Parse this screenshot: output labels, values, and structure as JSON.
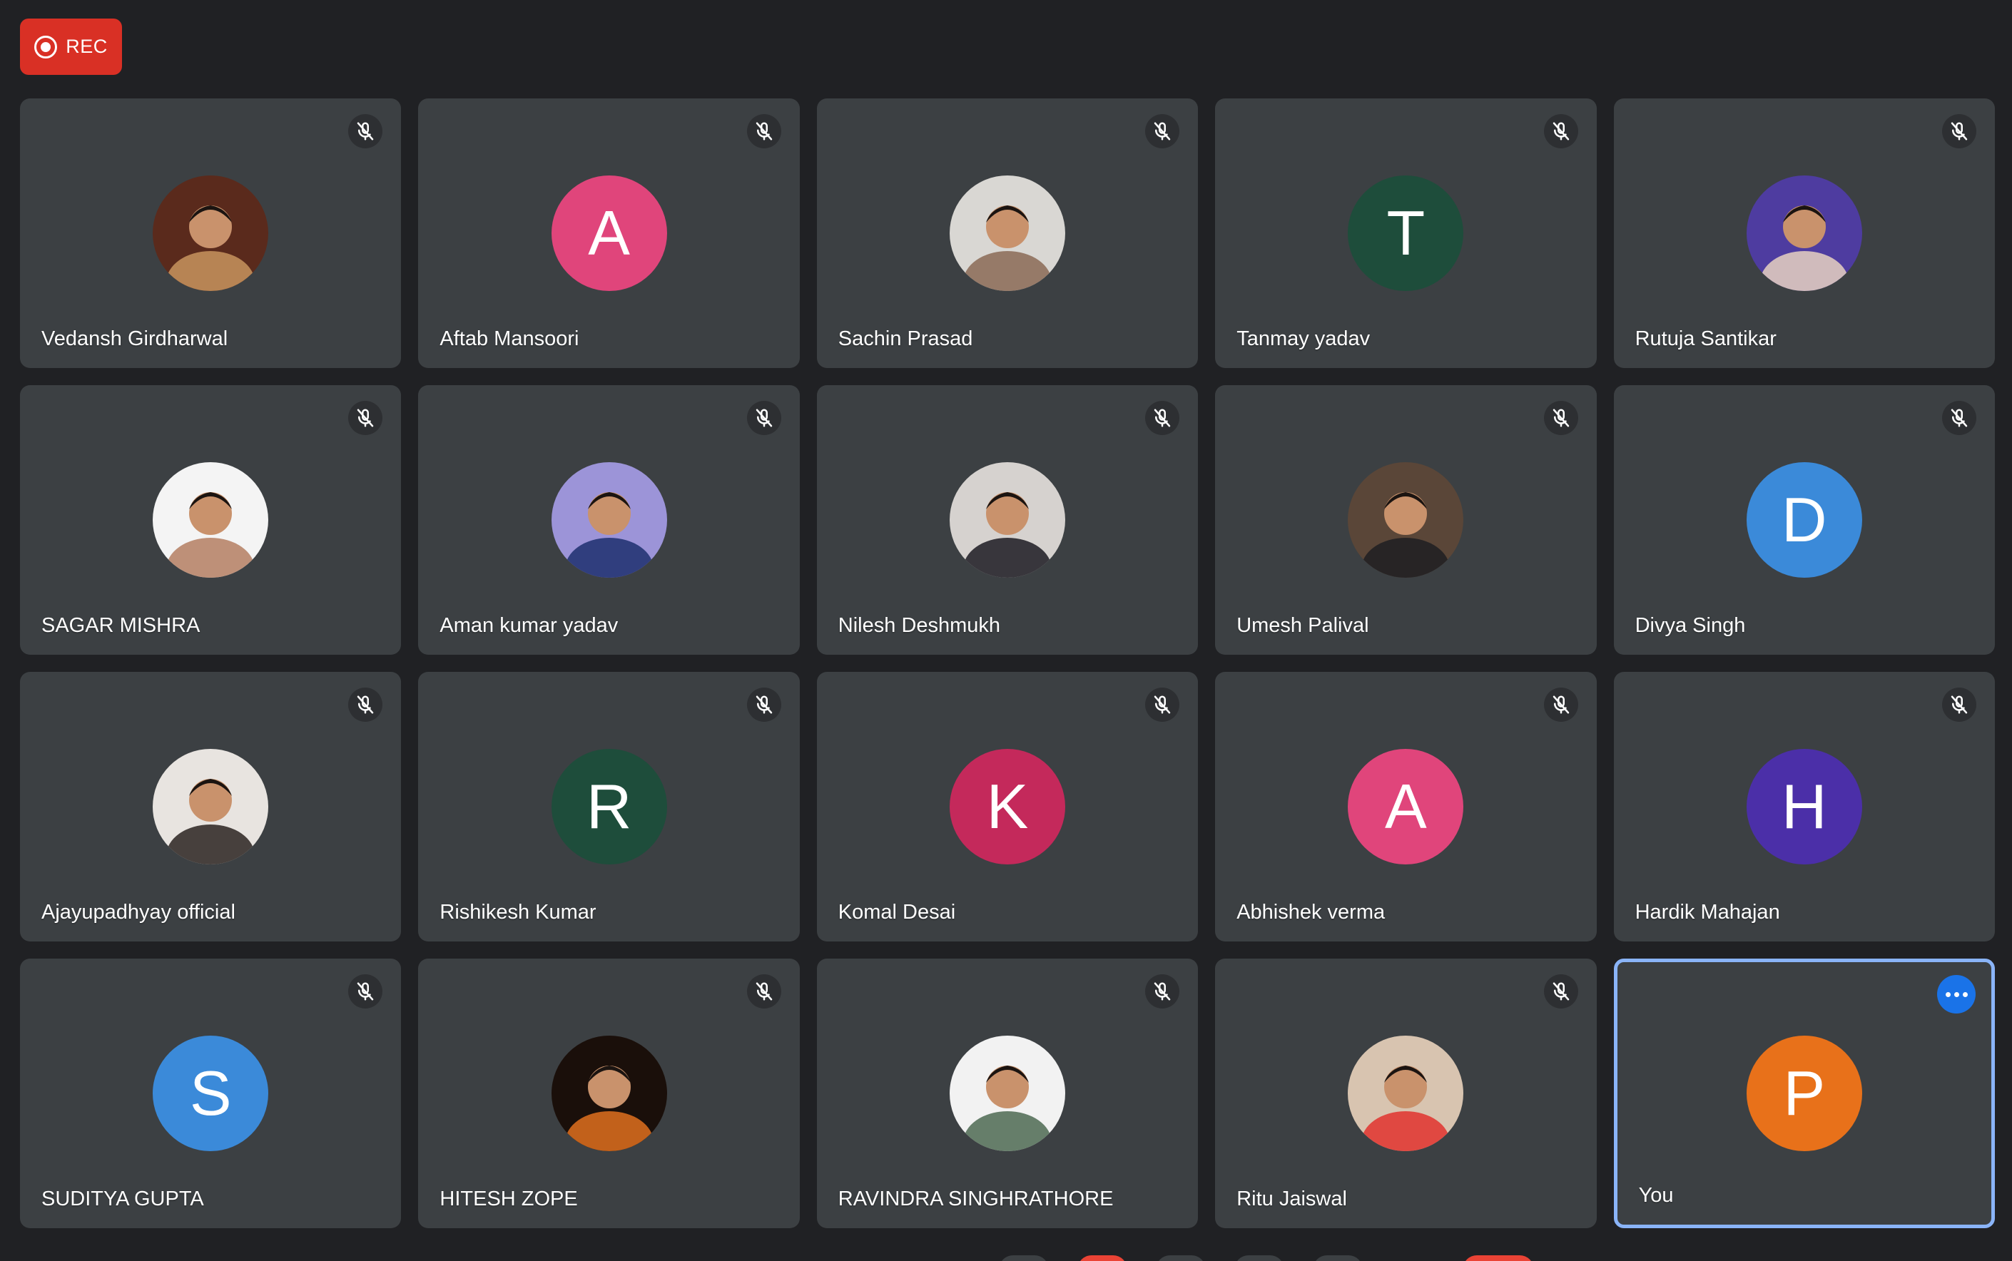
{
  "recording": {
    "label": "REC",
    "color": "#d93025"
  },
  "self_tile": {
    "border_color": "#8ab4f8",
    "more_icon": "more-horiz-icon"
  },
  "participants": [
    {
      "name": "Vedansh Girdharwal",
      "avatar": "photo",
      "photo_tone": [
        "#5a2a1c",
        "#c8945e"
      ],
      "muted": true
    },
    {
      "name": "Aftab Mansoori",
      "avatar": "initial",
      "initial": "A",
      "color": "#e0457b",
      "muted": true
    },
    {
      "name": "Sachin Prasad",
      "avatar": "photo",
      "photo_tone": [
        "#d9d7d3",
        "#8a6a55"
      ],
      "muted": true
    },
    {
      "name": "Tanmay yadav",
      "avatar": "initial",
      "initial": "T",
      "color": "#1e4d3b",
      "muted": true
    },
    {
      "name": "Rutuja Santikar",
      "avatar": "photo",
      "photo_tone": [
        "#4e3ca0",
        "#e7d1c1"
      ],
      "muted": true
    },
    {
      "name": "SAGAR MISHRA",
      "avatar": "photo",
      "photo_tone": [
        "#f4f4f4",
        "#b47e62"
      ],
      "muted": true
    },
    {
      "name": "Aman kumar yadav",
      "avatar": "photo",
      "photo_tone": [
        "#9c94d8",
        "#1d2f6e"
      ],
      "muted": true
    },
    {
      "name": "Nilesh Deshmukh",
      "avatar": "photo",
      "photo_tone": [
        "#d6d2cf",
        "#1c1b22"
      ],
      "muted": true
    },
    {
      "name": "Umesh Palival",
      "avatar": "photo",
      "photo_tone": [
        "#5a4638",
        "#1e1e22"
      ],
      "muted": true
    },
    {
      "name": "Divya Singh",
      "avatar": "initial",
      "initial": "D",
      "color": "#3b8ad9",
      "muted": true
    },
    {
      "name": "Ajayupadhyay official",
      "avatar": "photo",
      "photo_tone": [
        "#e8e4e0",
        "#2a2320"
      ],
      "muted": true
    },
    {
      "name": "Rishikesh Kumar",
      "avatar": "initial",
      "initial": "R",
      "color": "#1e4d3b",
      "muted": true
    },
    {
      "name": "Komal Desai",
      "avatar": "initial",
      "initial": "K",
      "color": "#c4295b",
      "muted": true
    },
    {
      "name": "Abhishek verma",
      "avatar": "initial",
      "initial": "A",
      "color": "#e0457b",
      "muted": true
    },
    {
      "name": "Hardik Mahajan",
      "avatar": "initial",
      "initial": "H",
      "color": "#4b2fa8",
      "muted": true
    },
    {
      "name": "SUDITYA GUPTA",
      "avatar": "initial",
      "initial": "S",
      "color": "#3b8ad9",
      "muted": true
    },
    {
      "name": "HITESH ZOPE",
      "avatar": "photo",
      "photo_tone": [
        "#1a0f0a",
        "#e0701f"
      ],
      "muted": true
    },
    {
      "name": "RAVINDRA SINGHRATHORE",
      "avatar": "photo",
      "photo_tone": [
        "#f2f2f2",
        "#4d6a52"
      ],
      "muted": true
    },
    {
      "name": "Ritu Jaiswal",
      "avatar": "photo",
      "photo_tone": [
        "#d8c4b0",
        "#e2332e"
      ],
      "muted": true
    },
    {
      "name": "You",
      "avatar": "initial",
      "initial": "P",
      "color": "#e8711a",
      "muted": false,
      "is_self": true
    }
  ]
}
